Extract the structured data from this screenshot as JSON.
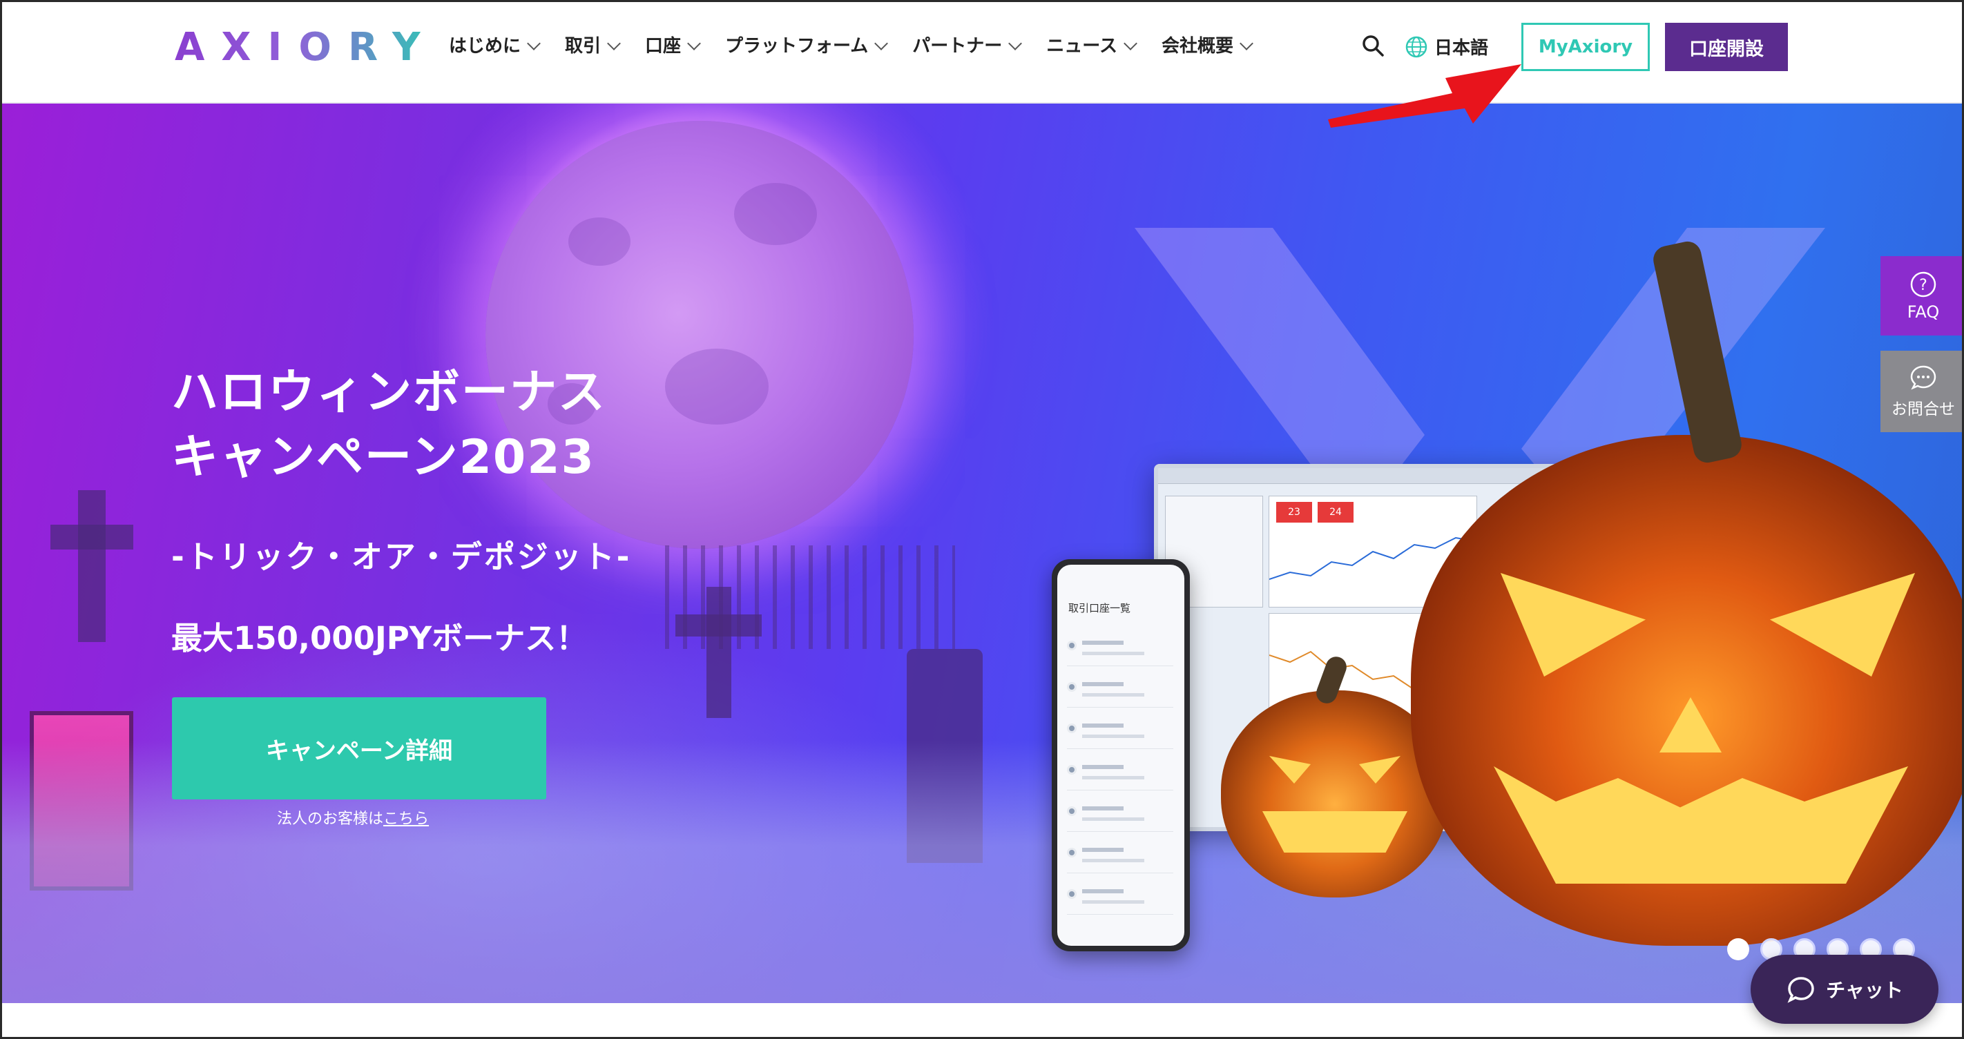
{
  "header": {
    "logo_text": "AXIORY",
    "nav": [
      {
        "label": "はじめに"
      },
      {
        "label": "取引"
      },
      {
        "label": "口座"
      },
      {
        "label": "プラットフォーム"
      },
      {
        "label": "パートナー"
      },
      {
        "label": "ニュース"
      },
      {
        "label": "会社概要"
      }
    ],
    "language": "日本語",
    "myaxiory_label": "MyAxiory",
    "open_account_label": "口座開設"
  },
  "hero": {
    "title_line1": "ハロウィンボーナス",
    "title_line2": "キャンペーン2023",
    "subtitle": "-トリック・オア・デポジット-",
    "bonus": "最大150,000JPYボーナス！",
    "cta_label": "キャンペーン詳細",
    "corp_prefix": "法人のお客様は",
    "corp_link": "こちら",
    "phone_title": "取引口座一覧",
    "quote1": "23",
    "quote2": "24"
  },
  "side": {
    "faq_label": "FAQ",
    "contact_label": "お問合せ"
  },
  "carousel": {
    "dots": 6,
    "active_index": 0
  },
  "chat": {
    "label": "チャット"
  },
  "colors": {
    "brand_purple": "#5b2c8f",
    "accent_teal": "#2dc9ad",
    "faq_purple": "#8b2ccd",
    "annotation_red": "#e8141c"
  }
}
